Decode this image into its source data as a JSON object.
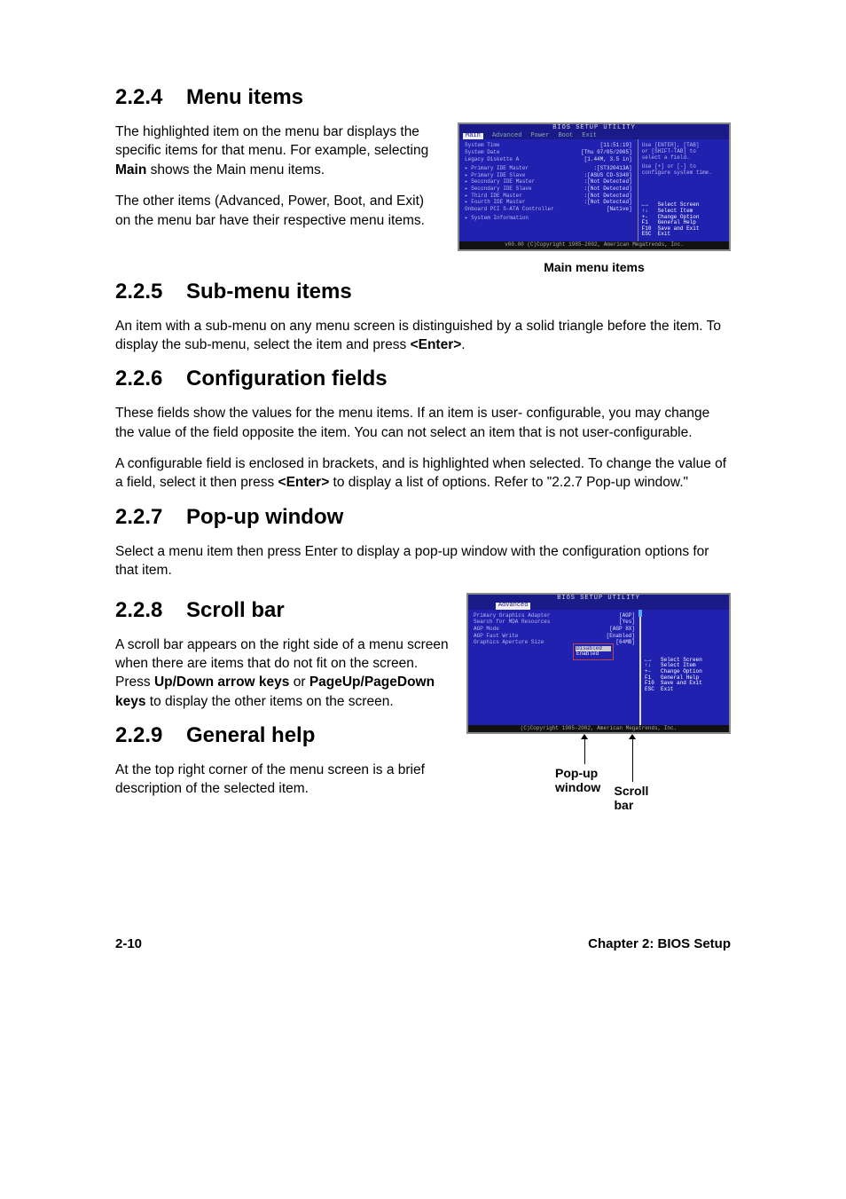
{
  "sections": {
    "s224": {
      "num": "2.2.4",
      "title": "Menu items"
    },
    "s225": {
      "num": "2.2.5",
      "title": "Sub-menu items"
    },
    "s226": {
      "num": "2.2.6",
      "title": "Configuration fields"
    },
    "s227": {
      "num": "2.2.7",
      "title": "Pop-up window"
    },
    "s228": {
      "num": "2.2.8",
      "title": "Scroll bar"
    },
    "s229": {
      "num": "2.2.9",
      "title": "General help"
    }
  },
  "paras": {
    "p224a": "The highlighted item on the menu bar displays the specific items for that menu. For example, selecting ",
    "p224a_bold": "Main",
    "p224a_end": " shows the Main menu items.",
    "p224b": "The other items (Advanced, Power, Boot, and Exit) on the menu bar have their respective menu items.",
    "p225": "An item with a sub-menu on any menu screen is distinguished by a solid triangle before the item. To display the sub-menu, select the item and press ",
    "p225_bold": "<Enter>",
    "p225_end": ".",
    "p226a": "These fields show the values for the menu items. If an item is user- configurable, you may change the value of the field opposite the item. You can not select an item that is not user-configurable.",
    "p226b": "A configurable field is enclosed in brackets, and is highlighted when selected. To change the value of a field, select it then press ",
    "p226b_bold": "<Enter>",
    "p226b_end": " to display a list of options. Refer to \"2.2.7 Pop-up window.\"",
    "p227": "Select a menu item then press Enter to display a pop-up window with the configuration options for that item.",
    "p228a": "A scroll bar appears on the right side of a menu screen when there are items that do not fit on the screen. Press ",
    "p228_bold1": "Up/Down arrow keys",
    "p228_mid": " or ",
    "p228_bold2": "PageUp/PageDown keys",
    "p228_end": " to display the other items on the screen.",
    "p229": "At the top right corner of the menu screen is a brief description of the selected item."
  },
  "fig1": {
    "caption": "Main menu items",
    "bios_title": "BIOS SETUP UTILITY",
    "tabs": [
      "Main",
      "Advanced",
      "Power",
      "Boot",
      "Exit"
    ],
    "active_tab": "Main",
    "rows": [
      {
        "label": "System Time",
        "val": "[11:51:19]"
      },
      {
        "label": "System Date",
        "val": "[Thu 07/05/2005]"
      },
      {
        "label": "Legacy Diskette A",
        "val": "[1.44M, 3.5 in]"
      },
      {
        "label": "▸ Primary IDE Master",
        "val": ":[ST320413A]"
      },
      {
        "label": "▸ Primary IDE Slave",
        "val": ":[ASUS CD-S340]"
      },
      {
        "label": "▸ Secondary IDE Master",
        "val": ":[Not Detected]"
      },
      {
        "label": "▸ Secondary IDE Slave",
        "val": ":[Not Detected]"
      },
      {
        "label": "▸ Third IDE Master",
        "val": ":[Not Detected]"
      },
      {
        "label": "▸ Fourth IDE Master",
        "val": ":[Not Detected]"
      },
      {
        "label": "Onboard PCI S-ATA Controller",
        "val": "[Native]"
      },
      {
        "label": "▸ System Information",
        "val": ""
      }
    ],
    "help_top": [
      "Use [ENTER], [TAB]",
      "or [SHIFT-TAB] to",
      "select a field.",
      "",
      "Use [+] or [-] to",
      "configure system time."
    ],
    "help_keys": [
      {
        "k": "←→",
        "d": "Select Screen"
      },
      {
        "k": "↑↓",
        "d": "Select Item"
      },
      {
        "k": "+-",
        "d": "Change Option"
      },
      {
        "k": "F1",
        "d": "General Help"
      },
      {
        "k": "F10",
        "d": "Save and Exit"
      },
      {
        "k": "ESC",
        "d": "Exit"
      }
    ],
    "footer": "v00.00 (C)Copyright 1985-2002, American Megatrends, Inc."
  },
  "fig2": {
    "bios_title": "BIOS SETUP UTILITY",
    "active_tab": "Advanced",
    "rows": [
      {
        "label": "Primary Graphics Adapter",
        "val": "[AGP]"
      },
      {
        "label": "Search for MDA Resources",
        "val": "[Yes]"
      },
      {
        "label": "AGP Mode",
        "val": "[AGP 8X]"
      },
      {
        "label": "AGP Fast Write",
        "val": "[Enabled]"
      },
      {
        "label": "Graphics Aperture Size",
        "val": "[64MB]"
      }
    ],
    "popup_opts": [
      "Disabled",
      "Enabled"
    ],
    "help_keys": [
      {
        "k": "←→",
        "d": "Select Screen"
      },
      {
        "k": "↑↓",
        "d": "Select Item"
      },
      {
        "k": "+-",
        "d": "Change Option"
      },
      {
        "k": "F1",
        "d": "General Help"
      },
      {
        "k": "F10",
        "d": "Save and Exit"
      },
      {
        "k": "ESC",
        "d": "Exit"
      }
    ],
    "footer": "(C)Copyright 1985-2002, American Megatrends, Inc.",
    "callout_popup": "Pop-up window",
    "callout_scroll": "Scroll bar"
  },
  "footer": {
    "page": "2-10",
    "chapter": "Chapter 2: BIOS Setup"
  }
}
